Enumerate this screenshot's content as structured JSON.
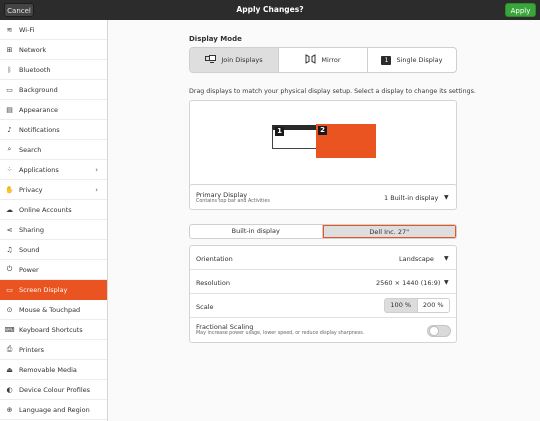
{
  "header": {
    "cancel_label": "Cancel",
    "title": "Apply Changes?",
    "apply_label": "Apply"
  },
  "sidebar": {
    "items": [
      {
        "label": "Wi-Fi",
        "icon": "wifi-icon",
        "glyph": "≋"
      },
      {
        "label": "Network",
        "icon": "network-icon",
        "glyph": "⊞"
      },
      {
        "label": "Bluetooth",
        "icon": "bluetooth-icon",
        "glyph": "ᛒ"
      },
      {
        "label": "Background",
        "icon": "background-icon",
        "glyph": "▭"
      },
      {
        "label": "Appearance",
        "icon": "appearance-icon",
        "glyph": "▤"
      },
      {
        "label": "Notifications",
        "icon": "notifications-icon",
        "glyph": "♪"
      },
      {
        "label": "Search",
        "icon": "search-icon",
        "glyph": "⌕"
      },
      {
        "label": "Applications",
        "icon": "applications-icon",
        "glyph": "⁘",
        "chevron": "›"
      },
      {
        "label": "Privacy",
        "icon": "privacy-icon",
        "glyph": "✋",
        "chevron": "›"
      },
      {
        "label": "Online Accounts",
        "icon": "online-accounts-icon",
        "glyph": "☁"
      },
      {
        "label": "Sharing",
        "icon": "sharing-icon",
        "glyph": "⋖"
      },
      {
        "label": "Sound",
        "icon": "sound-icon",
        "glyph": "♫"
      },
      {
        "label": "Power",
        "icon": "power-icon",
        "glyph": "⏻"
      },
      {
        "label": "Screen Display",
        "icon": "display-icon",
        "glyph": "▭",
        "active": true
      },
      {
        "label": "Mouse & Touchpad",
        "icon": "mouse-icon",
        "glyph": "⊙"
      },
      {
        "label": "Keyboard Shortcuts",
        "icon": "keyboard-icon",
        "glyph": "⌨"
      },
      {
        "label": "Printers",
        "icon": "printer-icon",
        "glyph": "⎙"
      },
      {
        "label": "Removable Media",
        "icon": "removable-media-icon",
        "glyph": "⏏"
      },
      {
        "label": "Device Colour Profiles",
        "icon": "colour-profiles-icon",
        "glyph": "◐"
      },
      {
        "label": "Language and Region",
        "icon": "language-icon",
        "glyph": "⊕"
      }
    ]
  },
  "display_mode": {
    "title": "Display Mode",
    "options": [
      {
        "label": "Join Displays",
        "icon": "join-displays-icon",
        "selected": true
      },
      {
        "label": "Mirror",
        "icon": "mirror-icon",
        "selected": false
      },
      {
        "label": "Single Display",
        "icon": "single-display-icon",
        "badge": "1",
        "selected": false
      }
    ]
  },
  "arrangement": {
    "hint": "Drag displays to match your physical display setup. Select a display to change its settings.",
    "monitor_1_label": "1",
    "monitor_2_label": "2"
  },
  "primary": {
    "title": "Primary Display",
    "subtitle": "Contains top bar and Activities",
    "value": "1   Built-in display"
  },
  "display_tabs": [
    {
      "label": "Built-in display",
      "selected": false
    },
    {
      "label": "Dell Inc. 27\"",
      "selected": true
    }
  ],
  "settings": {
    "orientation_label": "Orientation",
    "orientation_value": "Landscape",
    "resolution_label": "Resolution",
    "resolution_value": "2560 × 1440 (16:9)",
    "scale_label": "Scale",
    "scale_options": [
      "100 %",
      "200 %"
    ],
    "scale_selected": "100 %",
    "fractional_label": "Fractional Scaling",
    "fractional_sub": "May increase power usage, lower speed, or reduce display sharpness.",
    "fractional_on": false
  },
  "colors": {
    "accent": "#e95420",
    "apply_green": "#3aa53a",
    "header_bg": "#2c2c2c"
  }
}
